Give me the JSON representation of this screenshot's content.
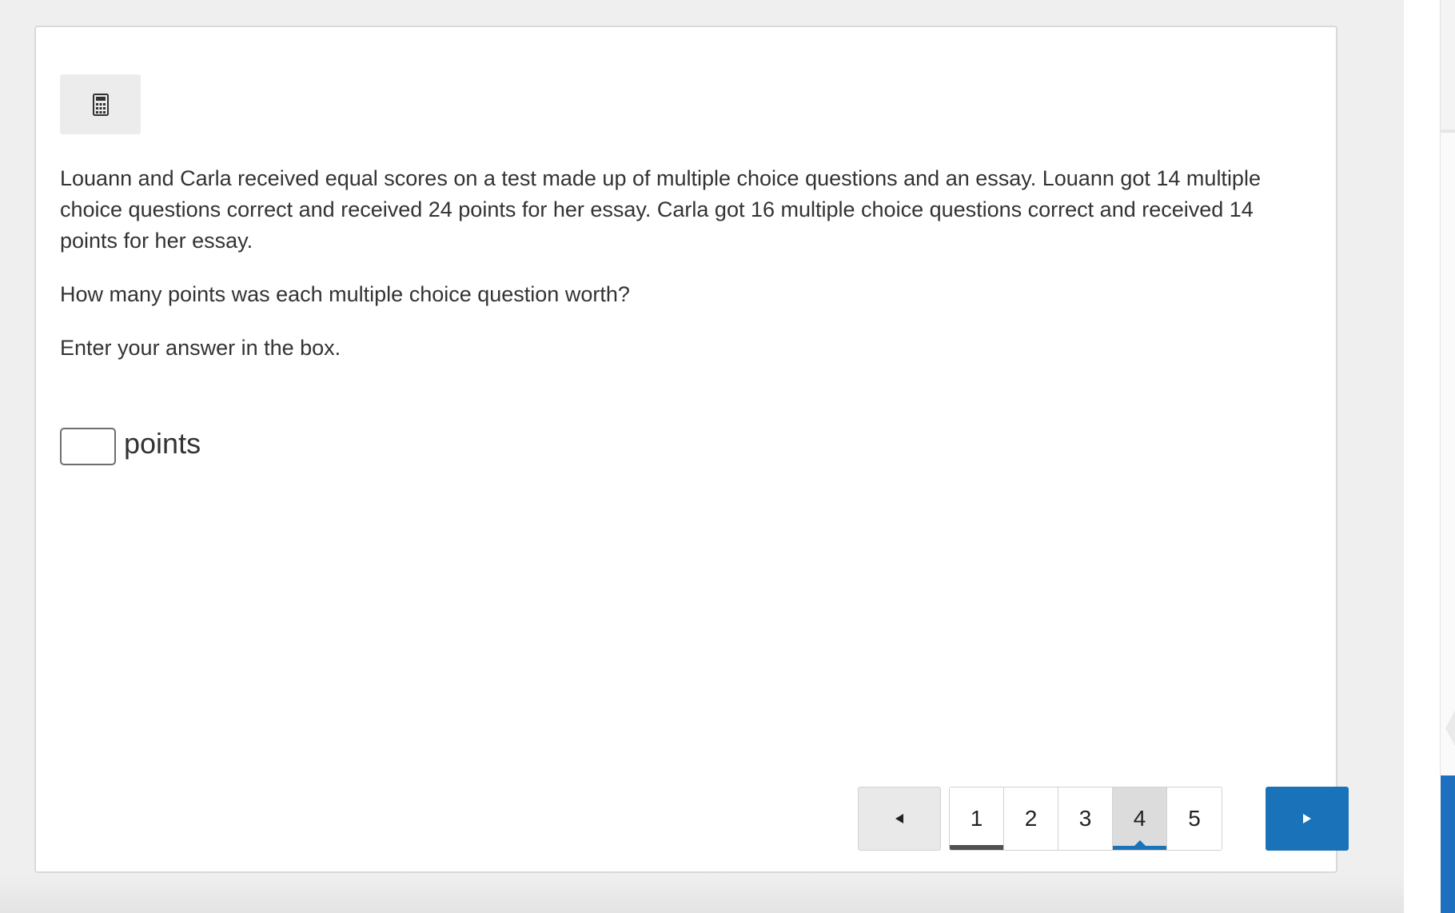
{
  "toolbar": {
    "calculator_icon": "calculator-icon"
  },
  "question": {
    "paragraph1": "Louann and Carla received equal scores on a test made up of multiple choice questions and an essay. Louann got 14 multiple choice questions correct and received 24 points for her essay. Carla got 16 multiple choice questions correct and received 14 points for her essay.",
    "paragraph2": "How many points was each multiple choice question worth?",
    "instruction": "Enter your answer in the box."
  },
  "answer": {
    "value": "",
    "unit": "points"
  },
  "pagination": {
    "prev_icon": "left-triangle-icon",
    "next_icon": "right-triangle-icon",
    "pages": [
      {
        "label": "1",
        "state": "visited"
      },
      {
        "label": "2",
        "state": "default"
      },
      {
        "label": "3",
        "state": "default"
      },
      {
        "label": "4",
        "state": "current"
      },
      {
        "label": "5",
        "state": "default"
      }
    ]
  },
  "colors": {
    "accent": "#1a73b8",
    "text": "#333333",
    "background": "#efefef"
  }
}
